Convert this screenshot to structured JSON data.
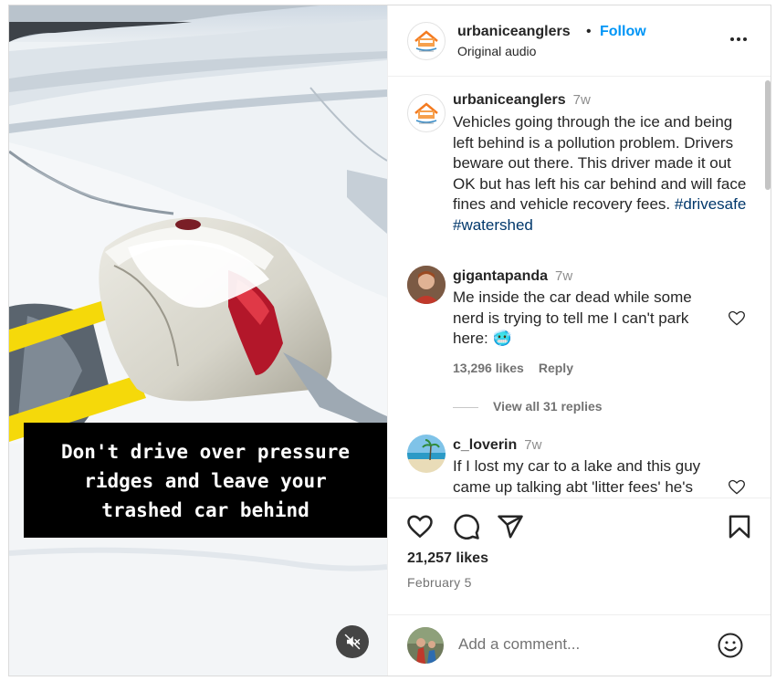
{
  "video": {
    "caption_lines": [
      "Don't drive over pressure",
      "ridges and leave your",
      "trashed car behind"
    ],
    "mute_icon": "speaker-muted-icon"
  },
  "header": {
    "username": "urbaniceanglers",
    "separator": "•",
    "follow_label": "Follow",
    "audio_label": "Original audio",
    "more_icon": "more-horizontal-icon"
  },
  "post": {
    "username": "urbaniceanglers",
    "time": "7w",
    "caption": "Vehicles going through the ice and being left behind is a pollution problem. Drivers beware out there. This driver made it out OK but has left his car behind and will face fines and vehicle recovery fees.",
    "hashtags": "#drivesafe #watershed"
  },
  "comments": [
    {
      "username": "gigantapanda",
      "time": "7w",
      "text": "Me inside the car dead while some nerd is trying to tell me I can't park here:",
      "emoji": "🥶",
      "likes": "13,296 likes",
      "reply_label": "Reply",
      "view_replies": "View all 31 replies"
    },
    {
      "username": "c_loverin",
      "time": "7w",
      "text": "If I lost my car to a lake and this guy came up talking abt 'litter fees' he's"
    }
  ],
  "actions": {
    "icons": [
      "heart-icon",
      "comment-icon",
      "share-icon",
      "bookmark-icon"
    ],
    "likes": "21,257 likes",
    "date": "February 5"
  },
  "add_comment": {
    "placeholder": "Add a comment...",
    "emoji_icon": "smiley-icon"
  },
  "colors": {
    "follow": "#0095f6",
    "hashtag": "#00376b",
    "muted_text": "#737373",
    "caption_bg": "#000000",
    "strap": "#f5d90a"
  }
}
